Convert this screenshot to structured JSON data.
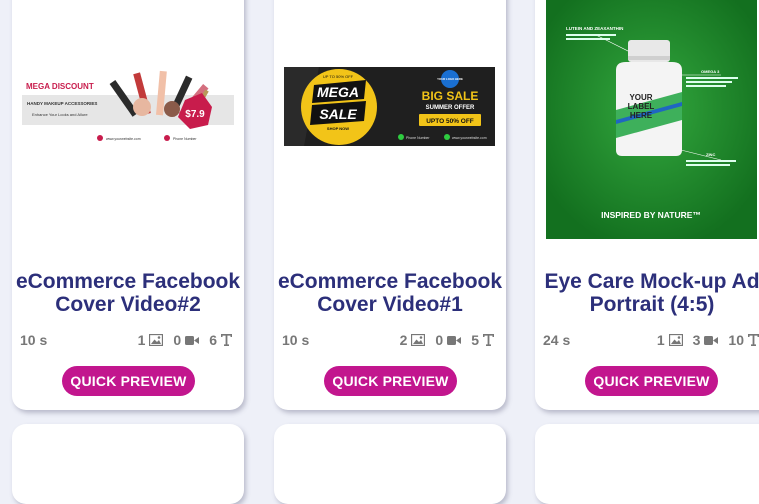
{
  "cards": [
    {
      "title": "eCommerce Facebook\nCover Video#2",
      "duration": "10 s",
      "images": "1",
      "videos": "0",
      "texts": "6",
      "button": "QUICK PREVIEW",
      "thumb": {
        "headline": "MEGA DISCOUNT",
        "line1": "HANDY MAKEUP ACCESSORIES",
        "line2": "Enhance Your Looks and Allure",
        "price": "$7.9",
        "website": "www.yourwebsite.com",
        "phone": "Phone Number"
      }
    },
    {
      "title": "eCommerce Facebook\nCover Video#1",
      "duration": "10 s",
      "images": "2",
      "videos": "0",
      "texts": "5",
      "button": "QUICK PREVIEW",
      "thumb": {
        "tag_top": "UP TO 50% OFF",
        "mega": "MEGA",
        "sale": "SALE",
        "shop": "SHOP NOW",
        "logo": "YOUR LOGO HERE",
        "big_sale": "BIG SALE",
        "summer": "SUMMER OFFER",
        "upto": "UPTO 50% OFF",
        "phone": "Phone Number",
        "website": "www.yourwebsite.com"
      }
    },
    {
      "title": "Eye Care Mock-up Ad\nPortrait (4:5)",
      "duration": "24 s",
      "images": "1",
      "videos": "3",
      "texts": "10",
      "button": "QUICK PREVIEW",
      "thumb": {
        "top_label": "LUTEIN AND ZEAXANTHIN",
        "omega": "OMEGA 3",
        "zinc": "ZINC",
        "bottle_label": "YOUR\nLABEL\nHERE",
        "tagline": "INSPIRED BY NATURE™"
      }
    }
  ],
  "colors": {
    "title": "#2c2f7a",
    "button": "#c2168e",
    "background": "#eef0f8",
    "green": "#1e8a2e"
  }
}
